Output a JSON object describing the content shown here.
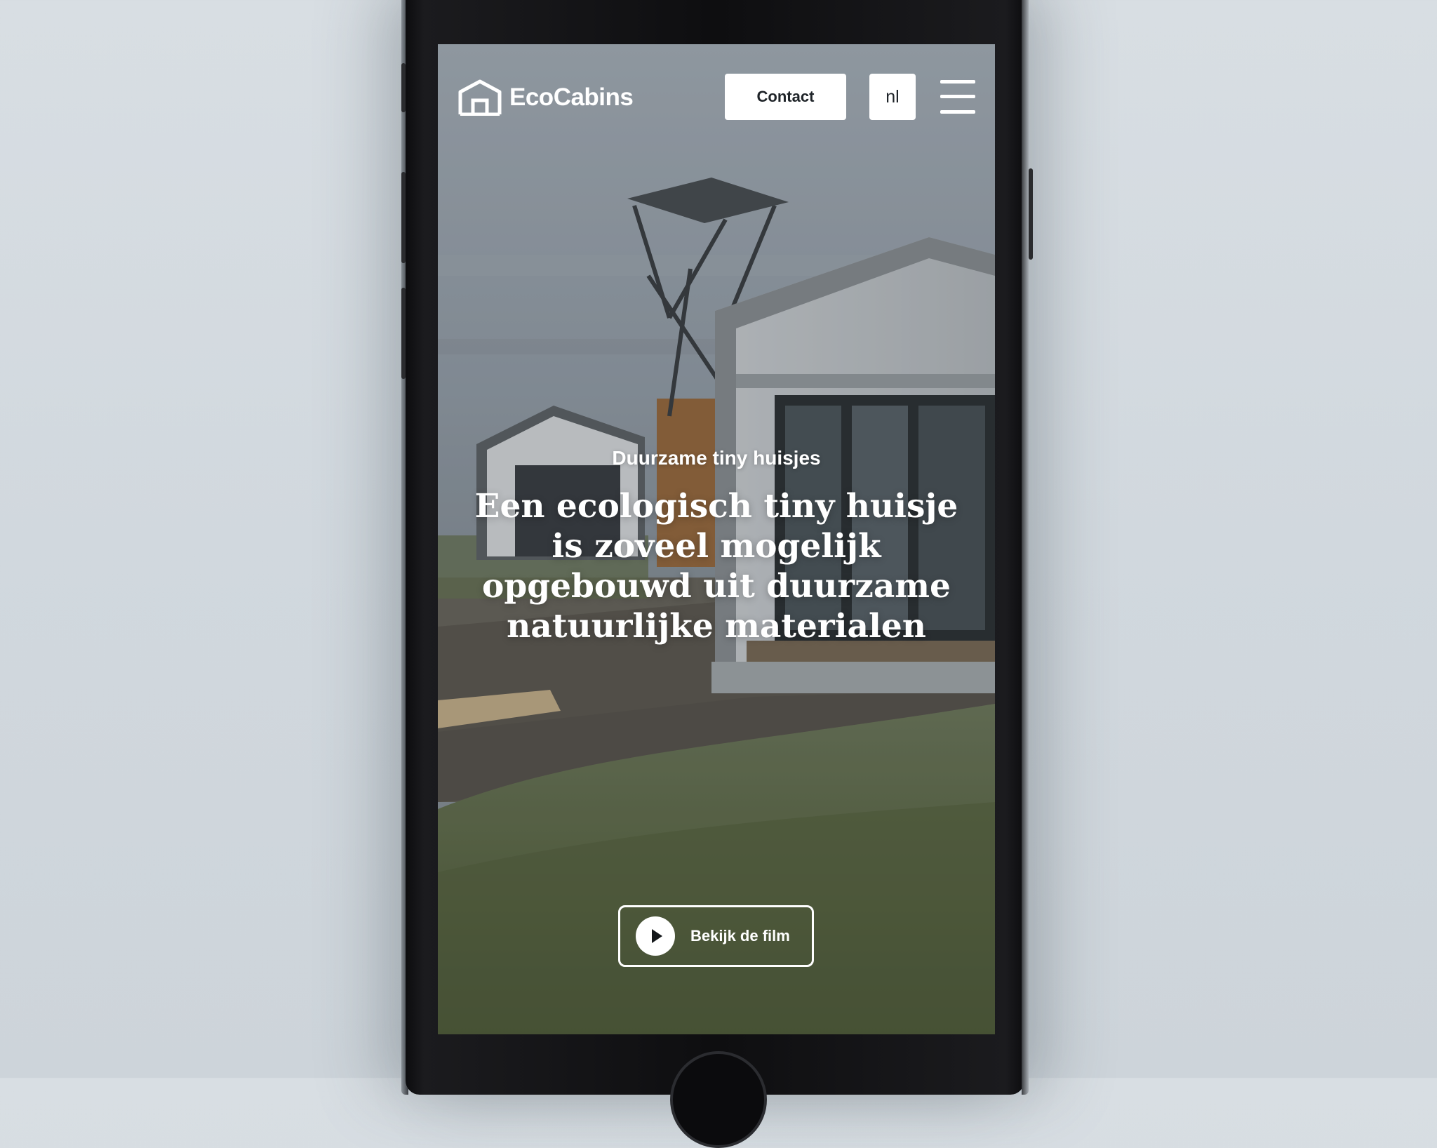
{
  "header": {
    "brand_name": "EcoCabins",
    "contact_label": "Contact",
    "language_label": "nl",
    "menu_icon": "hamburger-menu-icon",
    "logo_icon": "house-outline-icon"
  },
  "hero": {
    "subtitle": "Duurzame tiny huisjes",
    "headline": "Een ecologisch tiny huisje is zoveel mogelijk opgebouwd uit duurzame natuurlijke materialen",
    "cta_label": "Bekijk de film",
    "cta_icon": "play-icon"
  },
  "colors": {
    "button_bg": "#ffffff",
    "button_text": "#1e2328",
    "hero_text": "#ffffff",
    "background_wall": "#d8dee3"
  }
}
